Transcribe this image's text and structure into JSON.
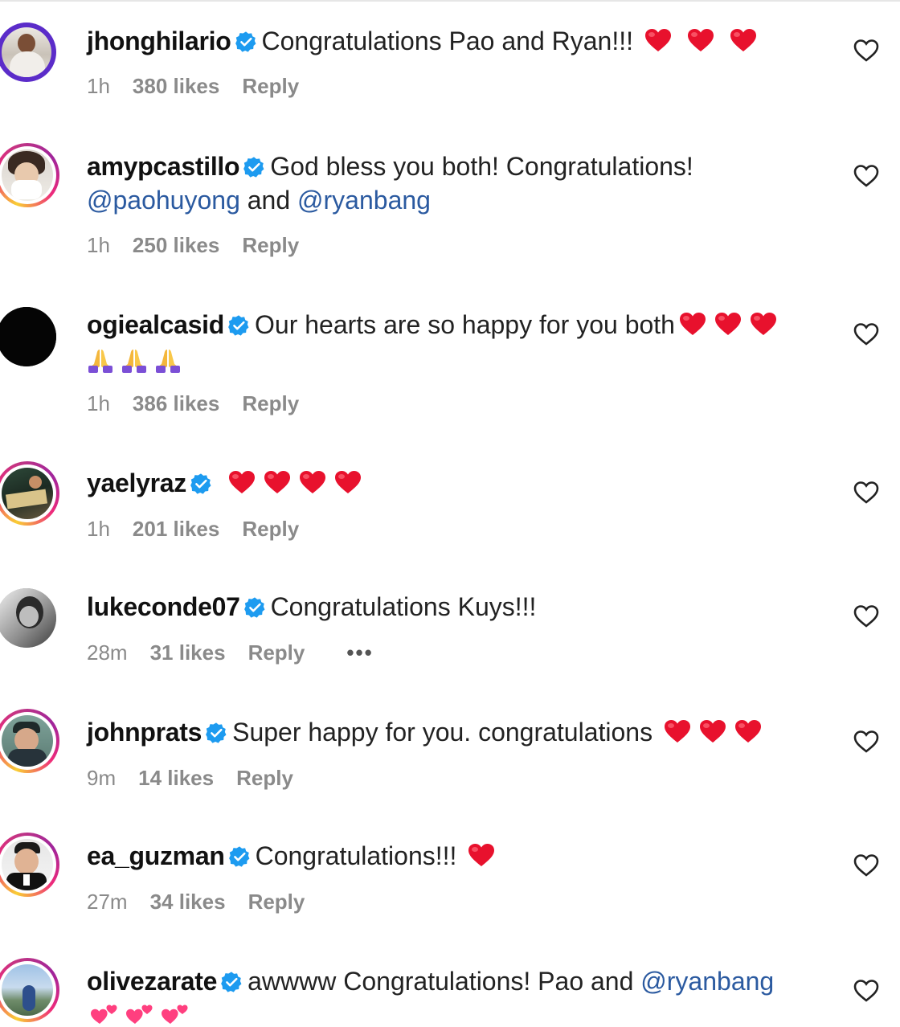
{
  "comments": [
    {
      "username": "jhonghilario",
      "pre": "Congratulations Pao and Ryan!!!",
      "mention1": "",
      "mid": "",
      "mention2": "",
      "post": "",
      "emojis": "hearts-3",
      "time": "1h",
      "likes": "380 likes",
      "reply": "Reply",
      "avatar_icon": "avatar-photo",
      "heart_color": "#e8112d"
    },
    {
      "username": "amypcastillo",
      "pre": "God bless you both! Congratulations!",
      "mention1": "@paohuyong",
      "mid": " and ",
      "mention2": "@ryanbang",
      "post": "",
      "emojis": "none",
      "time": "1h",
      "likes": "250 likes",
      "reply": "Reply",
      "avatar_icon": "avatar-photo"
    },
    {
      "username": "ogiealcasid",
      "pre": "Our hearts are so happy for you both",
      "mention1": "",
      "mid": "",
      "mention2": "",
      "post": "",
      "emojis": "hearts-3-pray-3",
      "time": "1h",
      "likes": "386 likes",
      "reply": "Reply",
      "avatar_icon": "avatar-photo"
    },
    {
      "username": "yaelyraz",
      "pre": "",
      "mention1": "",
      "mid": "",
      "mention2": "",
      "post": "",
      "emojis": "hearts-4",
      "time": "1h",
      "likes": "201 likes",
      "reply": "Reply",
      "avatar_icon": "avatar-photo"
    },
    {
      "username": "lukeconde07",
      "pre": "Congratulations Kuys!!!",
      "mention1": "",
      "mid": "",
      "mention2": "",
      "post": "",
      "emojis": "none",
      "time": "28m",
      "likes": "31 likes",
      "reply": "Reply",
      "more": "•••",
      "avatar_icon": "avatar-photo"
    },
    {
      "username": "johnprats",
      "pre": "Super happy for you. congratulations",
      "mention1": "",
      "mid": "",
      "mention2": "",
      "post": "",
      "emojis": "hearts-3",
      "time": "9m",
      "likes": "14 likes",
      "reply": "Reply",
      "avatar_icon": "avatar-photo"
    },
    {
      "username": "ea_guzman",
      "pre": "Congratulations!!!",
      "mention1": "",
      "mid": "",
      "mention2": "",
      "post": "",
      "emojis": "hearts-1",
      "time": "27m",
      "likes": "34 likes",
      "reply": "Reply",
      "avatar_icon": "avatar-photo"
    },
    {
      "username": "olivezarate",
      "pre": "awwww Congratulations! Pao and ",
      "mention1": "@ryanbang",
      "mid": "",
      "mention2": "",
      "post": "",
      "emojis": "two-hearts-3",
      "time": "",
      "likes": "",
      "reply": "",
      "avatar_icon": "avatar-photo"
    }
  ],
  "colors": {
    "verified": "#1d9bf0",
    "heart": "#e8112d",
    "mention": "#2b5aa0",
    "meta": "#8a8a8a"
  }
}
